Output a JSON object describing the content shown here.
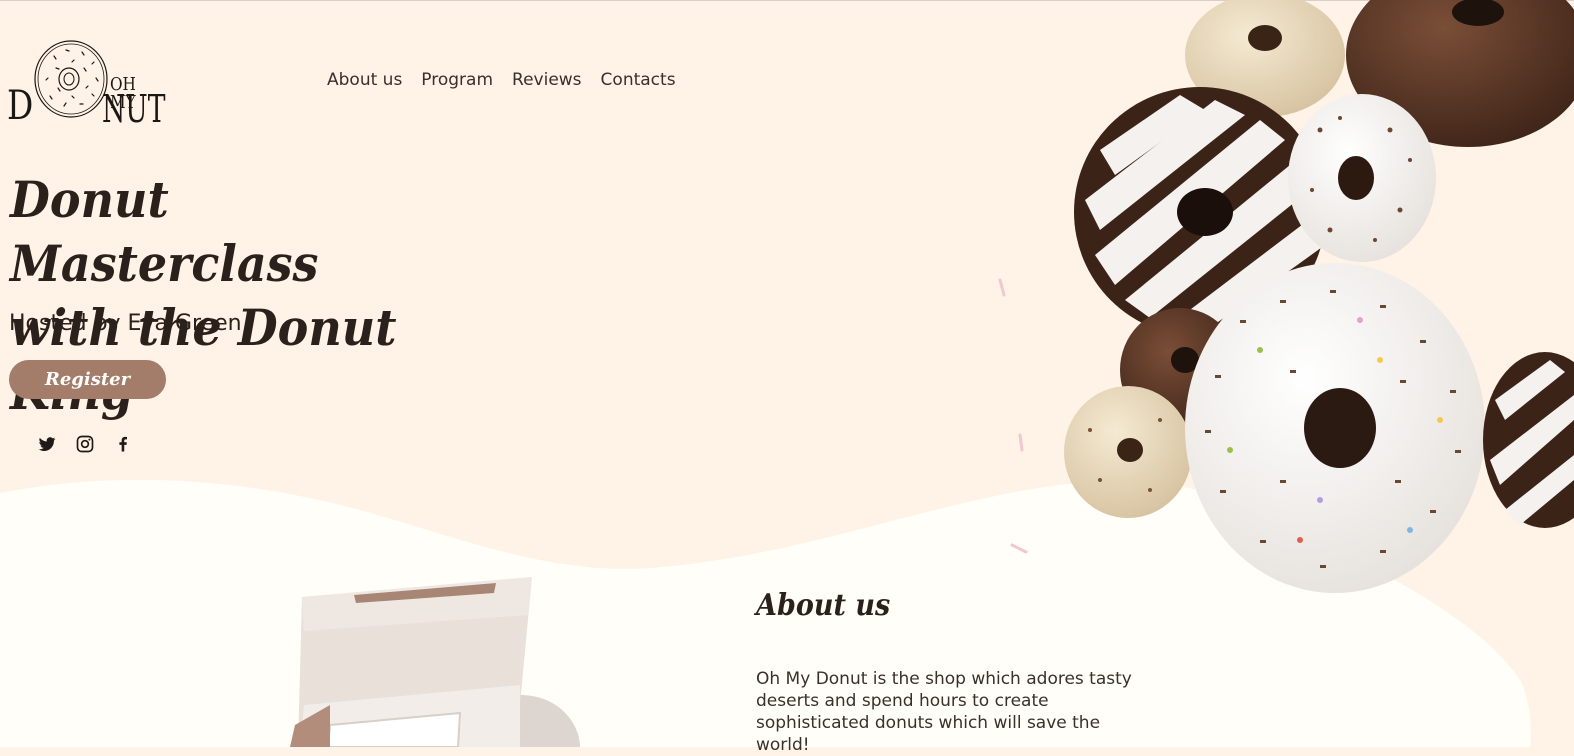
{
  "brand": {
    "logo_d": "D",
    "logo_top": "OH MY",
    "logo_bottom": "NUT"
  },
  "nav": {
    "items": [
      "About us",
      "Program",
      "Reviews",
      "Contacts"
    ]
  },
  "hero": {
    "title_line1": "Donut Masterclass",
    "title_line2": "with the Donut King",
    "subtitle": "Hosted by Eva Green",
    "register_label": "Register"
  },
  "socials": [
    "twitter-icon",
    "instagram-icon",
    "facebook-icon"
  ],
  "about": {
    "title": "About us",
    "text": "Oh My Donut is the shop which adores tasty deserts and spend hours to create sophisticated donuts which will save the world!"
  },
  "colors": {
    "background": "#fff2e6",
    "lower_background": "#fffef8",
    "accent": "#a47d6a",
    "text": "#2b211c"
  }
}
